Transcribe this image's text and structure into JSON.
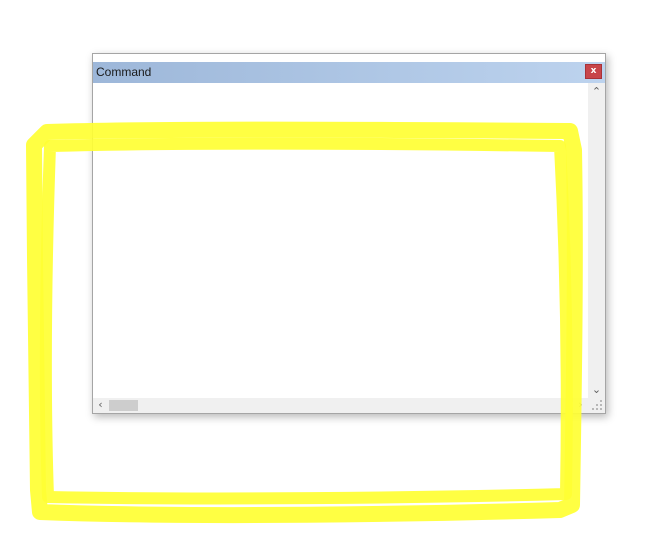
{
  "window": {
    "title": "Command",
    "close_glyph": "x",
    "close_color": "#c8454a",
    "titlebar_color": "#a9c2e3"
  },
  "scrollbars": {
    "up_glyph": "⌃",
    "down_glyph": "⌄",
    "left_glyph": "‹",
    "right_glyph": "›"
  },
  "annotation": {
    "type": "hand-drawn rectangle highlight",
    "color": "#ffff33"
  }
}
